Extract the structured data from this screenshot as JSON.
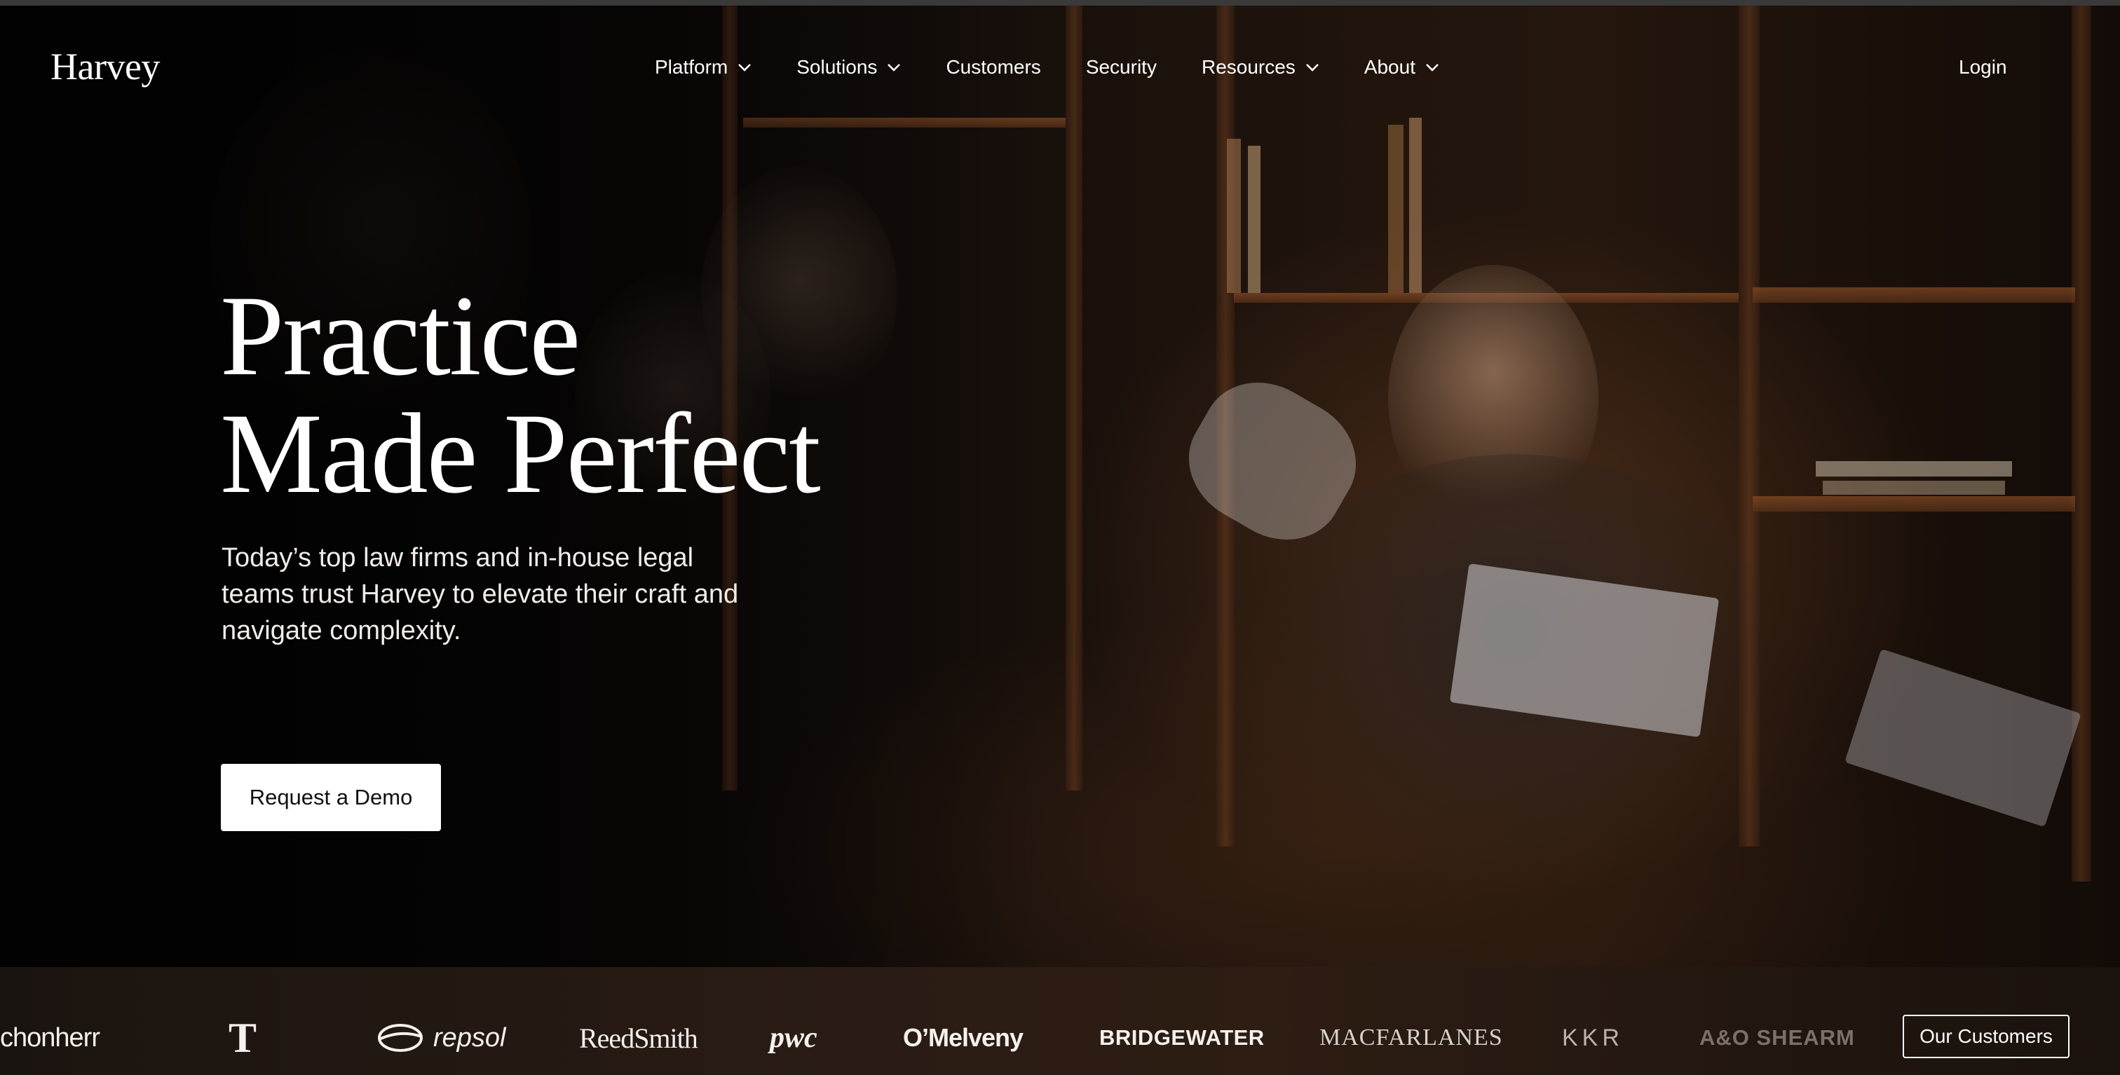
{
  "brand": {
    "logo": "Harvey"
  },
  "nav": {
    "items": [
      {
        "label": "Platform",
        "dropdown": true
      },
      {
        "label": "Solutions",
        "dropdown": true
      },
      {
        "label": "Customers",
        "dropdown": false
      },
      {
        "label": "Security",
        "dropdown": false
      },
      {
        "label": "Resources",
        "dropdown": true
      },
      {
        "label": "About",
        "dropdown": true
      }
    ],
    "login": "Login"
  },
  "hero": {
    "headline_line1": "Practice",
    "headline_line2": "Made Perfect",
    "subhead": "Today’s top law firms and in-house legal teams trust Harvey to elevate their craft and navigate complexity.",
    "cta": "Request a Demo"
  },
  "clients": {
    "logos": [
      "chonherr",
      "T",
      "repsol",
      "ReedSmith",
      "pwc",
      "O’Melveny",
      "BRIDGEWATER",
      "MACFARLANES",
      "KKR",
      "A&O SHEARM"
    ],
    "cta": "Our Customers"
  },
  "colors": {
    "background": "#070504",
    "accent_wood": "#8a4e26",
    "text": "#ffffff"
  }
}
